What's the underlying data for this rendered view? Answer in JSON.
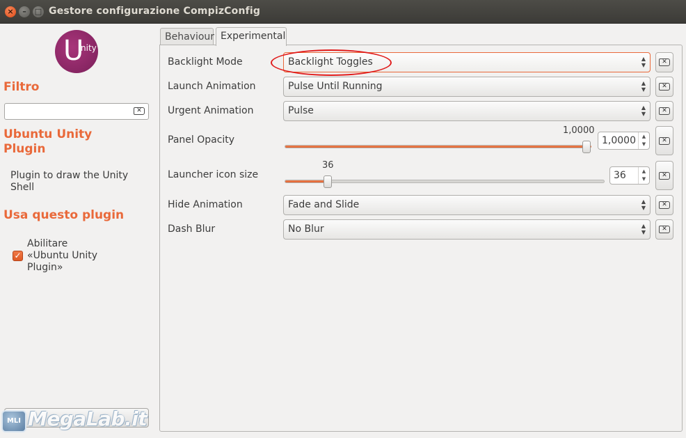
{
  "window": {
    "title": "Gestore configurazione CompizConfig",
    "close_glyph": "×",
    "min_glyph": "–",
    "max_glyph": "□"
  },
  "sidebar": {
    "logo_letter": "U",
    "logo_suffix": "nity",
    "filter_heading": "Filtro",
    "filter_value": "",
    "plugin_title": "Ubuntu Unity Plugin",
    "plugin_description": "Plugin to draw the Unity Shell",
    "use_heading": "Usa questo plugin",
    "enable_label": "Abilitare «Ubuntu Unity Plugin»",
    "enable_checked": true,
    "check_glyph": "✓"
  },
  "tabs": [
    {
      "label": "Behaviour",
      "active": false
    },
    {
      "label": "Experimental",
      "active": true
    }
  ],
  "settings": {
    "backlight_mode": {
      "label": "Backlight Mode",
      "value": "Backlight Toggles"
    },
    "launch_animation": {
      "label": "Launch Animation",
      "value": "Pulse Until Running"
    },
    "urgent_animation": {
      "label": "Urgent Animation",
      "value": "Pulse"
    },
    "panel_opacity": {
      "label": "Panel Opacity",
      "value_text": "1,0000",
      "spin_value": "1,0000",
      "fraction": 1.0
    },
    "launcher_icon_size": {
      "label": "Launcher icon size",
      "value_text": "36",
      "spin_value": "36",
      "fraction": 0.135
    },
    "hide_animation": {
      "label": "Hide Animation",
      "value": "Fade and Slide"
    },
    "dash_blur": {
      "label": "Dash Blur",
      "value": "No Blur"
    }
  },
  "glyphs": {
    "combo_arrows": "▲\n▼",
    "reset": "✕",
    "spin_up": "▲",
    "spin_down": "▼"
  },
  "watermark": {
    "badge": "MLI",
    "text": "MegaLab.it"
  },
  "colors": {
    "accent": "#e9693a",
    "annotation_circle": "#e01b1b",
    "titlebar": "#3c3b37"
  }
}
